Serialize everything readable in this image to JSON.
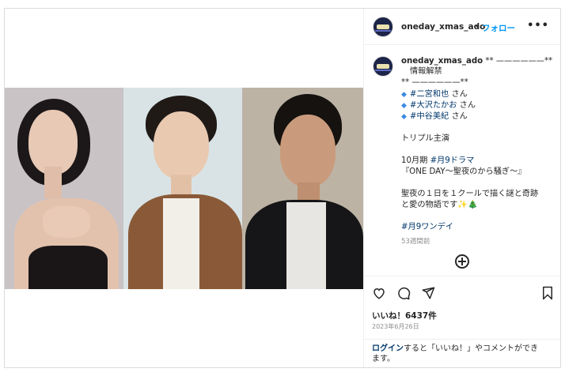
{
  "post": {
    "username": "oneday_xmas_ado",
    "separator": "•",
    "follow_label": "フォロー",
    "more_label": "•••"
  },
  "caption": {
    "username": "oneday_xmas_ado",
    "deco_right": "** ——————**",
    "announce": "情報解禁",
    "deco_line": "** ——————**",
    "cast": [
      {
        "tag": "#二宮和也",
        "suffix": " さん"
      },
      {
        "tag": "#大沢たかお",
        "suffix": " さん"
      },
      {
        "tag": "#中谷美紀",
        "suffix": " さん"
      }
    ],
    "triple": "トリプル主演",
    "period_prefix": "10月期 ",
    "period_tag": "#月9ドラマ",
    "title": "『ONE DAY～聖夜のから騒ぎ～』",
    "desc_line1": "聖夜の１日を１クールで描く謎と奇跡",
    "desc_line2": "と愛の物語です✨🎄",
    "hashtag": "#月9ワンデイ",
    "time_ago": "53週間前"
  },
  "actions": {
    "likes": "いいね！6437件",
    "date": "2023年6月26日",
    "login_link": "ログイン",
    "login_text_1": "すると「いいね！」やコメントができ",
    "login_text_2": "ます。"
  },
  "icons": [
    "heart-icon",
    "comment-icon",
    "share-icon",
    "bookmark-icon",
    "add-comment-icon",
    "more-icon"
  ]
}
